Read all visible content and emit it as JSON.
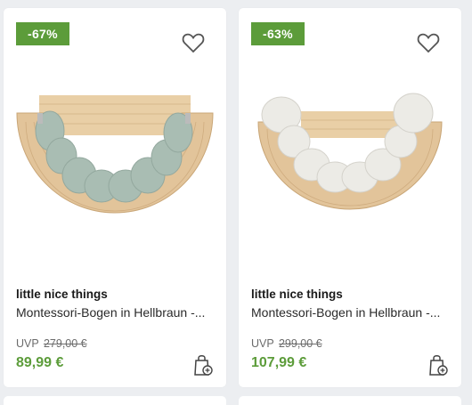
{
  "products": [
    {
      "discount": "-67%",
      "brand": "little nice things",
      "title": "Montessori-Bogen in Hellbraun -...",
      "uvp_label": "UVP",
      "old_price": "279,00 €",
      "price": "89,99 €",
      "cushion_color": "#a9bdb3",
      "icons": [
        "heart-icon",
        "cart-add-icon"
      ]
    },
    {
      "discount": "-63%",
      "brand": "little nice things",
      "title": "Montessori-Bogen in Hellbraun -...",
      "uvp_label": "UVP",
      "old_price": "299,00 €",
      "price": "107,99 €",
      "cushion_color": "#ecebe6",
      "icons": [
        "heart-icon",
        "cart-add-icon"
      ]
    }
  ],
  "colors": {
    "accent": "#5c9c3a",
    "wood": "#e2c49a"
  }
}
